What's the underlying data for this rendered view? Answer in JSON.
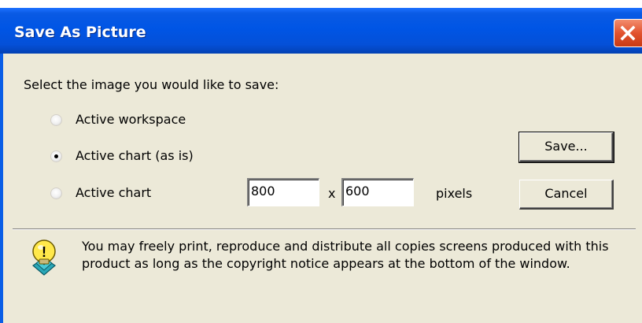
{
  "dialog": {
    "title": "Save As Picture",
    "prompt": "Select the image you would like to save:",
    "options": [
      {
        "label": "Active workspace",
        "selected": false
      },
      {
        "label": "Active chart (as is)",
        "selected": true
      },
      {
        "label": "Active chart",
        "selected": false
      }
    ],
    "size": {
      "width": "800",
      "height": "600",
      "separator": "x",
      "unit_label": "pixels"
    },
    "buttons": {
      "save": "Save...",
      "cancel": "Cancel"
    },
    "notice": "You may freely print, reproduce and distribute all copies screens produced with this product as long as the copyright notice appears at the bottom of the window.",
    "icons": {
      "close": "close-icon",
      "info": "info-bulb-icon"
    }
  }
}
